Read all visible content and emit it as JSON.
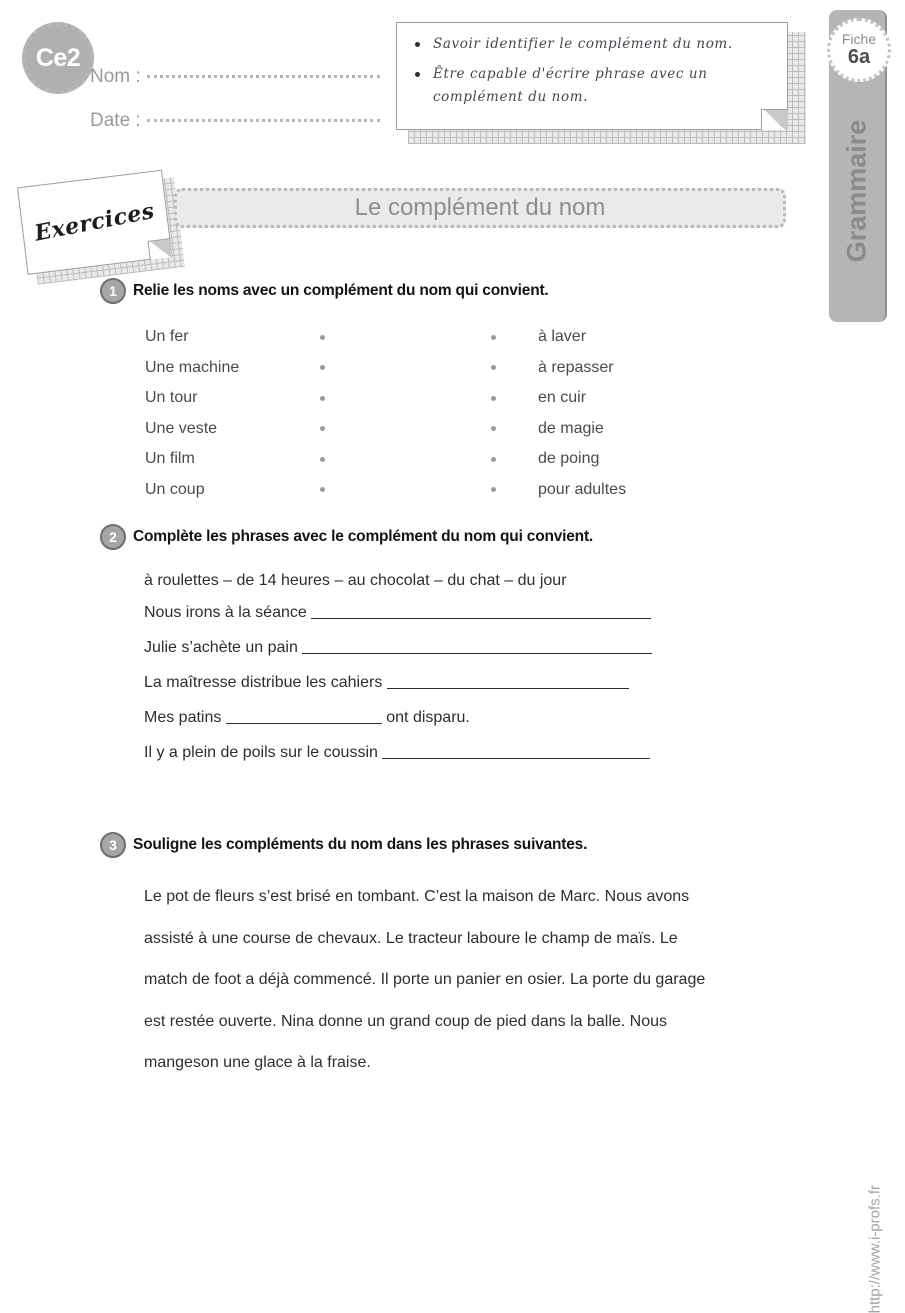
{
  "header": {
    "level_badge": "Ce2",
    "name_label": "Nom :",
    "date_label": "Date :",
    "objectives": [
      "Savoir identifier le complément du nom.",
      "Être capable d'écrire phrase avec un complément du nom."
    ]
  },
  "sidebar": {
    "fiche_label": "Fiche",
    "fiche_number": "6a",
    "subject": "Grammaire"
  },
  "banner": {
    "tag": "Exercices",
    "title": "Le complément du nom"
  },
  "exercises": [
    {
      "number": "1",
      "instruction": "Relie les noms avec un complément du nom qui convient.",
      "left_items": [
        "Un fer",
        "Une machine",
        "Un tour",
        "Une veste",
        "Un film",
        "Un coup"
      ],
      "right_items": [
        "à laver",
        "à repasser",
        "en cuir",
        "de magie",
        "de poing",
        "pour adultes"
      ]
    },
    {
      "number": "2",
      "instruction": "Complète les phrases avec le complément du nom qui convient.",
      "word_bank": "à roulettes – de 14 heures – au chocolat – du chat – du jour",
      "sentences": [
        {
          "before": "Nous irons à la séance ",
          "blank_width": 340,
          "after": ""
        },
        {
          "before": "Julie s’achète un pain ",
          "blank_width": 350,
          "after": ""
        },
        {
          "before": "La maîtresse distribue les cahiers ",
          "blank_width": 242,
          "after": ""
        },
        {
          "before": "Mes patins ",
          "blank_width": 156,
          "after": " ont disparu."
        },
        {
          "before": "Il y a plein de poils sur le coussin ",
          "blank_width": 268,
          "after": ""
        }
      ]
    },
    {
      "number": "3",
      "instruction": "Souligne les compléments du nom dans les phrases suivantes.",
      "paragraph": "Le pot de fleurs s’est brisé en tombant. C’est la maison de Marc. Nous avons assisté à une course de chevaux. Le tracteur laboure le champ de maïs.  Le match de foot a déjà commencé. Il porte un panier en osier. La porte du garage est restée ouverte. Nina donne un grand coup de pied dans la balle.  Nous mangeson une glace à la fraise."
    }
  ],
  "footer": {
    "url": "http://www.i-profs.fr"
  },
  "colors": {
    "gray_badge": "#b0b0b0",
    "sidebar": "#b5b5b5",
    "banner_fill": "#eaeaea",
    "text": "#2e2e2e"
  }
}
